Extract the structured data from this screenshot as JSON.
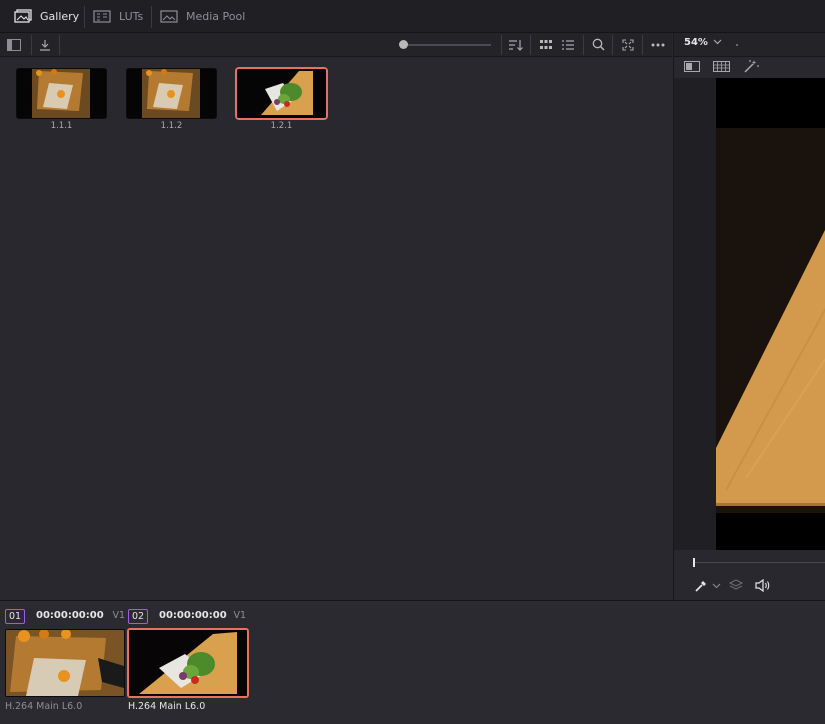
{
  "tabs": [
    {
      "label": "Gallery",
      "icon": "gallery-icon",
      "active": true
    },
    {
      "label": "LUTs",
      "icon": "luts-icon",
      "active": false
    },
    {
      "label": "Media Pool",
      "icon": "media-pool-icon",
      "active": false
    }
  ],
  "gallery": {
    "stills": [
      {
        "label": "1.1.1",
        "selected": false
      },
      {
        "label": "1.1.2",
        "selected": false
      },
      {
        "label": "1.2.1",
        "selected": true
      }
    ]
  },
  "viewer": {
    "zoom": "54%"
  },
  "clips": [
    {
      "number": "01",
      "timecode": "00:00:00:00",
      "track": "V1",
      "codec": "H.264 Main L6.0",
      "selected": false
    },
    {
      "number": "02",
      "timecode": "00:00:00:00",
      "track": "V1",
      "codec": "H.264 Main L6.0",
      "selected": true
    }
  ],
  "colors": {
    "selection": "#e8715f",
    "clip_number_border": "#9b5fe0"
  }
}
